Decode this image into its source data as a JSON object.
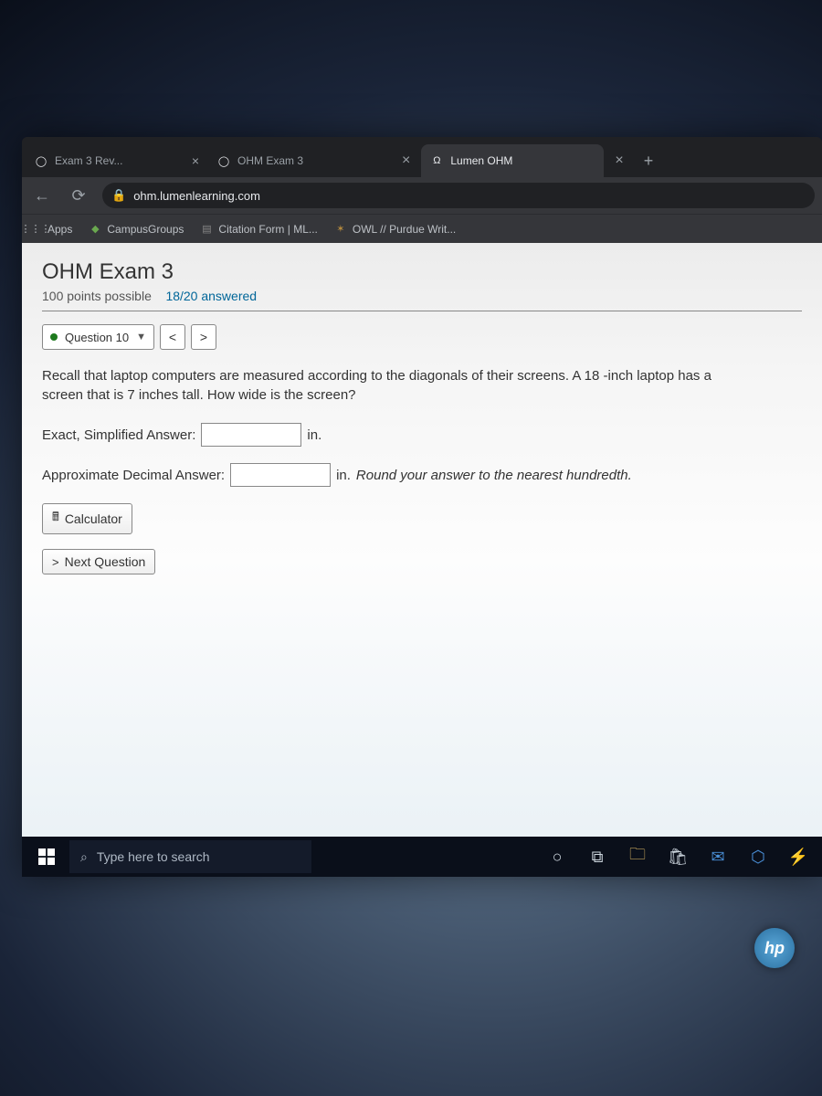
{
  "browser": {
    "tabs": [
      {
        "title": "Exam 3 Rev...",
        "favicon": "circle-icon"
      },
      {
        "title": "OHM Exam 3",
        "favicon": "circle-icon"
      },
      {
        "title": "Lumen OHM",
        "favicon": "omega-icon"
      }
    ],
    "active_tab_index": 2,
    "url_host": "ohm.lumenlearning.com"
  },
  "bookmarks": [
    {
      "icon": "apps-icon",
      "label": "Apps"
    },
    {
      "icon": "campus-icon",
      "label": "CampusGroups"
    },
    {
      "icon": "doc-icon",
      "label": "Citation Form | ML..."
    },
    {
      "icon": "owl-icon",
      "label": "OWL // Purdue Writ..."
    }
  ],
  "exam": {
    "title": "OHM Exam 3",
    "points_label": "100 points possible",
    "answered_label": "18/20 answered",
    "question_selector": "Question 10",
    "question_text": "Recall that laptop computers are measured according to the diagonals of their screens. A 18 -inch laptop has a screen that is 7 inches tall. How wide is the screen?",
    "exact_label": "Exact, Simplified Answer:",
    "exact_unit": "in.",
    "approx_label": "Approximate Decimal Answer:",
    "approx_unit": "in.",
    "approx_hint": "Round your answer to the nearest hundredth.",
    "calculator_label": "Calculator",
    "next_label": "Next Question"
  },
  "taskbar": {
    "search_placeholder": "Type here to search"
  },
  "hp": "hp"
}
